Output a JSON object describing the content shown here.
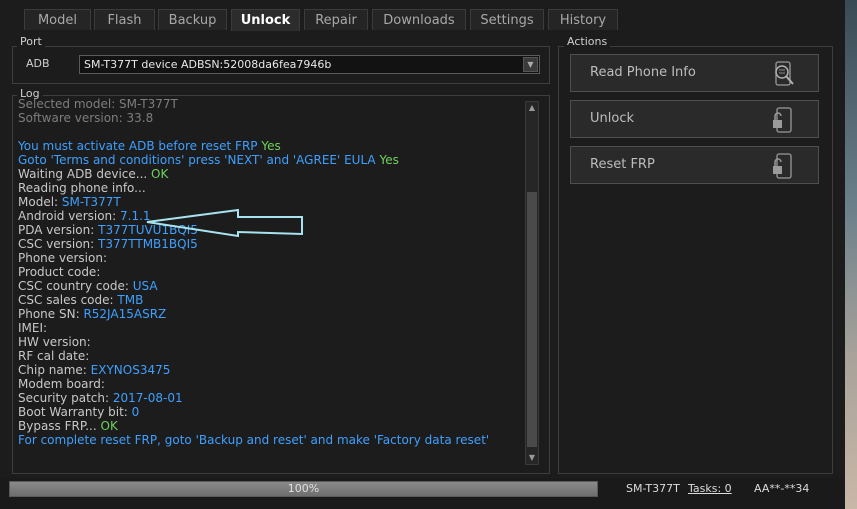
{
  "tabs": [
    {
      "label": "Model"
    },
    {
      "label": "Flash"
    },
    {
      "label": "Backup"
    },
    {
      "label": "Unlock",
      "active": true
    },
    {
      "label": "Repair"
    },
    {
      "label": "Downloads"
    },
    {
      "label": "Settings"
    },
    {
      "label": "History"
    }
  ],
  "port": {
    "group_label": "Port",
    "adb_label": "ADB",
    "selected": "SM-T377T device ADBSN:52008da6fea7946b"
  },
  "log": {
    "group_label": "Log",
    "lines": [
      {
        "text": "Selected model: SM-T377T",
        "style": "dim"
      },
      {
        "text": "Software version: 33.8",
        "style": "dim"
      },
      {
        "text": ""
      },
      {
        "text": "You must activate ADB before reset FRP",
        "style": "bl",
        "suffix": "Yes",
        "suffix_style": "gr"
      },
      {
        "text": "Goto 'Terms and conditions' press 'NEXT' and 'AGREE' EULA",
        "style": "bl",
        "suffix": "Yes",
        "suffix_style": "gr"
      },
      {
        "text": "Waiting ADB device...",
        "style": "wt",
        "suffix": "OK",
        "suffix_style": "gr"
      },
      {
        "text": "Reading phone info...",
        "style": "wt"
      },
      {
        "text": "Model:",
        "style": "wt",
        "suffix": "SM-T377T",
        "suffix_style": "val"
      },
      {
        "text": "Android version:",
        "style": "wt",
        "suffix": "7.1.1",
        "suffix_style": "val"
      },
      {
        "text": "PDA version:",
        "style": "wt",
        "suffix": "T377TUVU1BQI5",
        "suffix_style": "val"
      },
      {
        "text": "CSC version:",
        "style": "wt",
        "suffix": "T377TTMB1BQI5",
        "suffix_style": "val"
      },
      {
        "text": "Phone version:",
        "style": "wt"
      },
      {
        "text": "Product code:",
        "style": "wt"
      },
      {
        "text": "CSC country code:",
        "style": "wt",
        "suffix": "USA",
        "suffix_style": "val"
      },
      {
        "text": "CSC sales code:",
        "style": "wt",
        "suffix": "TMB",
        "suffix_style": "val"
      },
      {
        "text": "Phone SN:",
        "style": "wt",
        "suffix": "R52JA15ASRZ",
        "suffix_style": "val"
      },
      {
        "text": "IMEI:",
        "style": "wt"
      },
      {
        "text": "HW version:",
        "style": "wt"
      },
      {
        "text": "RF cal date:",
        "style": "wt"
      },
      {
        "text": "Chip name:",
        "style": "wt",
        "suffix": "EXYNOS3475",
        "suffix_style": "val"
      },
      {
        "text": "Modem board:",
        "style": "wt"
      },
      {
        "text": "Security patch:",
        "style": "wt",
        "suffix": "2017-08-01",
        "suffix_style": "val"
      },
      {
        "text": "Boot Warranty bit:",
        "style": "wt",
        "suffix": "0",
        "suffix_style": "val"
      },
      {
        "text": "Bypass FRP...",
        "style": "wt",
        "suffix": "OK",
        "suffix_style": "gr"
      },
      {
        "text": "For complete reset FRP, goto 'Backup and reset' and make 'Factory data reset'",
        "style": "bl"
      }
    ]
  },
  "actions": {
    "group_label": "Actions",
    "buttons": [
      {
        "label": "Read Phone Info",
        "icon": "phone-search-icon"
      },
      {
        "label": "Unlock",
        "icon": "phone-unlock-icon"
      },
      {
        "label": "Reset FRP",
        "icon": "phone-unlock-icon"
      }
    ]
  },
  "status": {
    "progress_percent": 100,
    "progress_text": "100%",
    "model": "SM-T377T",
    "tasks": "Tasks: 0",
    "serial": "AA**-**34"
  },
  "colors": {
    "log_value_blue": "#3ea0ff",
    "log_ok_green": "#6fd15d",
    "annotation_arrow": "#a8e4f0"
  }
}
